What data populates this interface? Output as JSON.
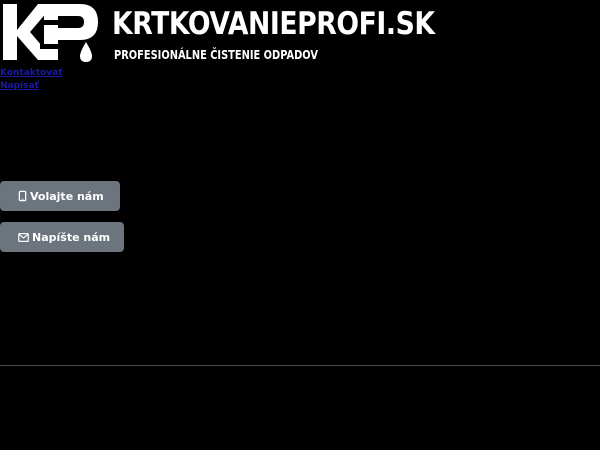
{
  "logo": {
    "mark_text": "KP",
    "wordmark": "KRTKOVANIEPROFI.SK",
    "tagline": "PROFESIONÁLNE ČISTENIE ODPADOV"
  },
  "nav": {
    "items": [
      {
        "label": "Kontaktovať"
      },
      {
        "label": "Napísať"
      }
    ]
  },
  "cta": {
    "call": {
      "label": "Volajte nám",
      "icon": "mobile-phone-icon"
    },
    "write": {
      "label": "Napíšte nám",
      "icon": "envelope-icon"
    }
  },
  "colors": {
    "background": "#000000",
    "button": "#6c757d",
    "text": "#ffffff",
    "link": "#1a1aa6"
  }
}
